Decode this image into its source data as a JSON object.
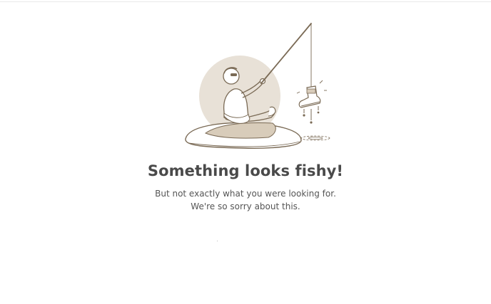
{
  "error_page": {
    "illustration_icon": "fisherman-catching-boot-icon",
    "headline": "Something looks fishy!",
    "message_line1": "But not exactly what you were looking for.",
    "message_line2": "We're so sorry about this."
  },
  "colors": {
    "headline_text": "#4a4a4a",
    "body_text": "#555555",
    "illustration_stroke": "#7a6a55",
    "illustration_fill": "#e8e1d7",
    "illustration_sand": "#d8ccba"
  }
}
